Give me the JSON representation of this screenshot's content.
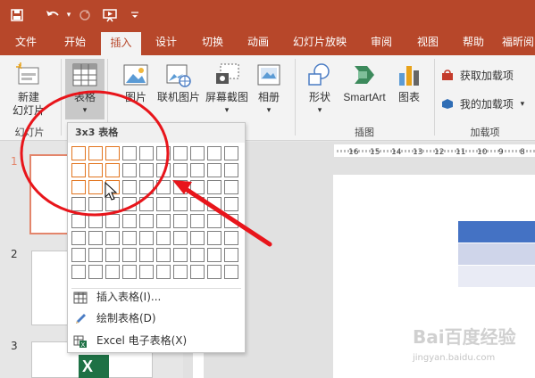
{
  "quick_access": {
    "customize": "▾"
  },
  "tabs": [
    "文件",
    "开始",
    "插入",
    "设计",
    "切换",
    "动画",
    "幻灯片放映",
    "审阅",
    "视图",
    "帮助",
    "福昕阅"
  ],
  "active_tab": "插入",
  "ribbon": {
    "new_slide": [
      "新建",
      "幻灯片"
    ],
    "table": "表格",
    "table_arrow": "▾",
    "picture": "图片",
    "online_picture": "联机图片",
    "screenshot": "屏幕截图",
    "album": "相册",
    "shapes": "形状",
    "smartart": "SmartArt",
    "chart": "图表",
    "get_addins": "获取加载项",
    "my_addins": "我的加载项",
    "groups": {
      "slides": "幻灯片",
      "illustrations": "插图",
      "addins": "加载项"
    }
  },
  "table_dropdown": {
    "header": "3x3 表格",
    "rows": 8,
    "cols": 10,
    "selected_rows": 3,
    "selected_cols": 3,
    "items": [
      "插入表格(I)...",
      "绘制表格(D)",
      "Excel 电子表格(X)"
    ]
  },
  "slide_numbers": [
    "1",
    "2",
    "3"
  ],
  "ruler_marks": [
    "16",
    "15",
    "14",
    "13",
    "12",
    "11",
    "10",
    "9",
    "8"
  ],
  "watermark": {
    "main": "Bai百度经验",
    "sub": "jingyan.baidu.com"
  },
  "colors": {
    "brand": "#b7472a",
    "highlight": "#e2751f",
    "annotation": "#e8151b",
    "table_header": "#4472c4"
  }
}
